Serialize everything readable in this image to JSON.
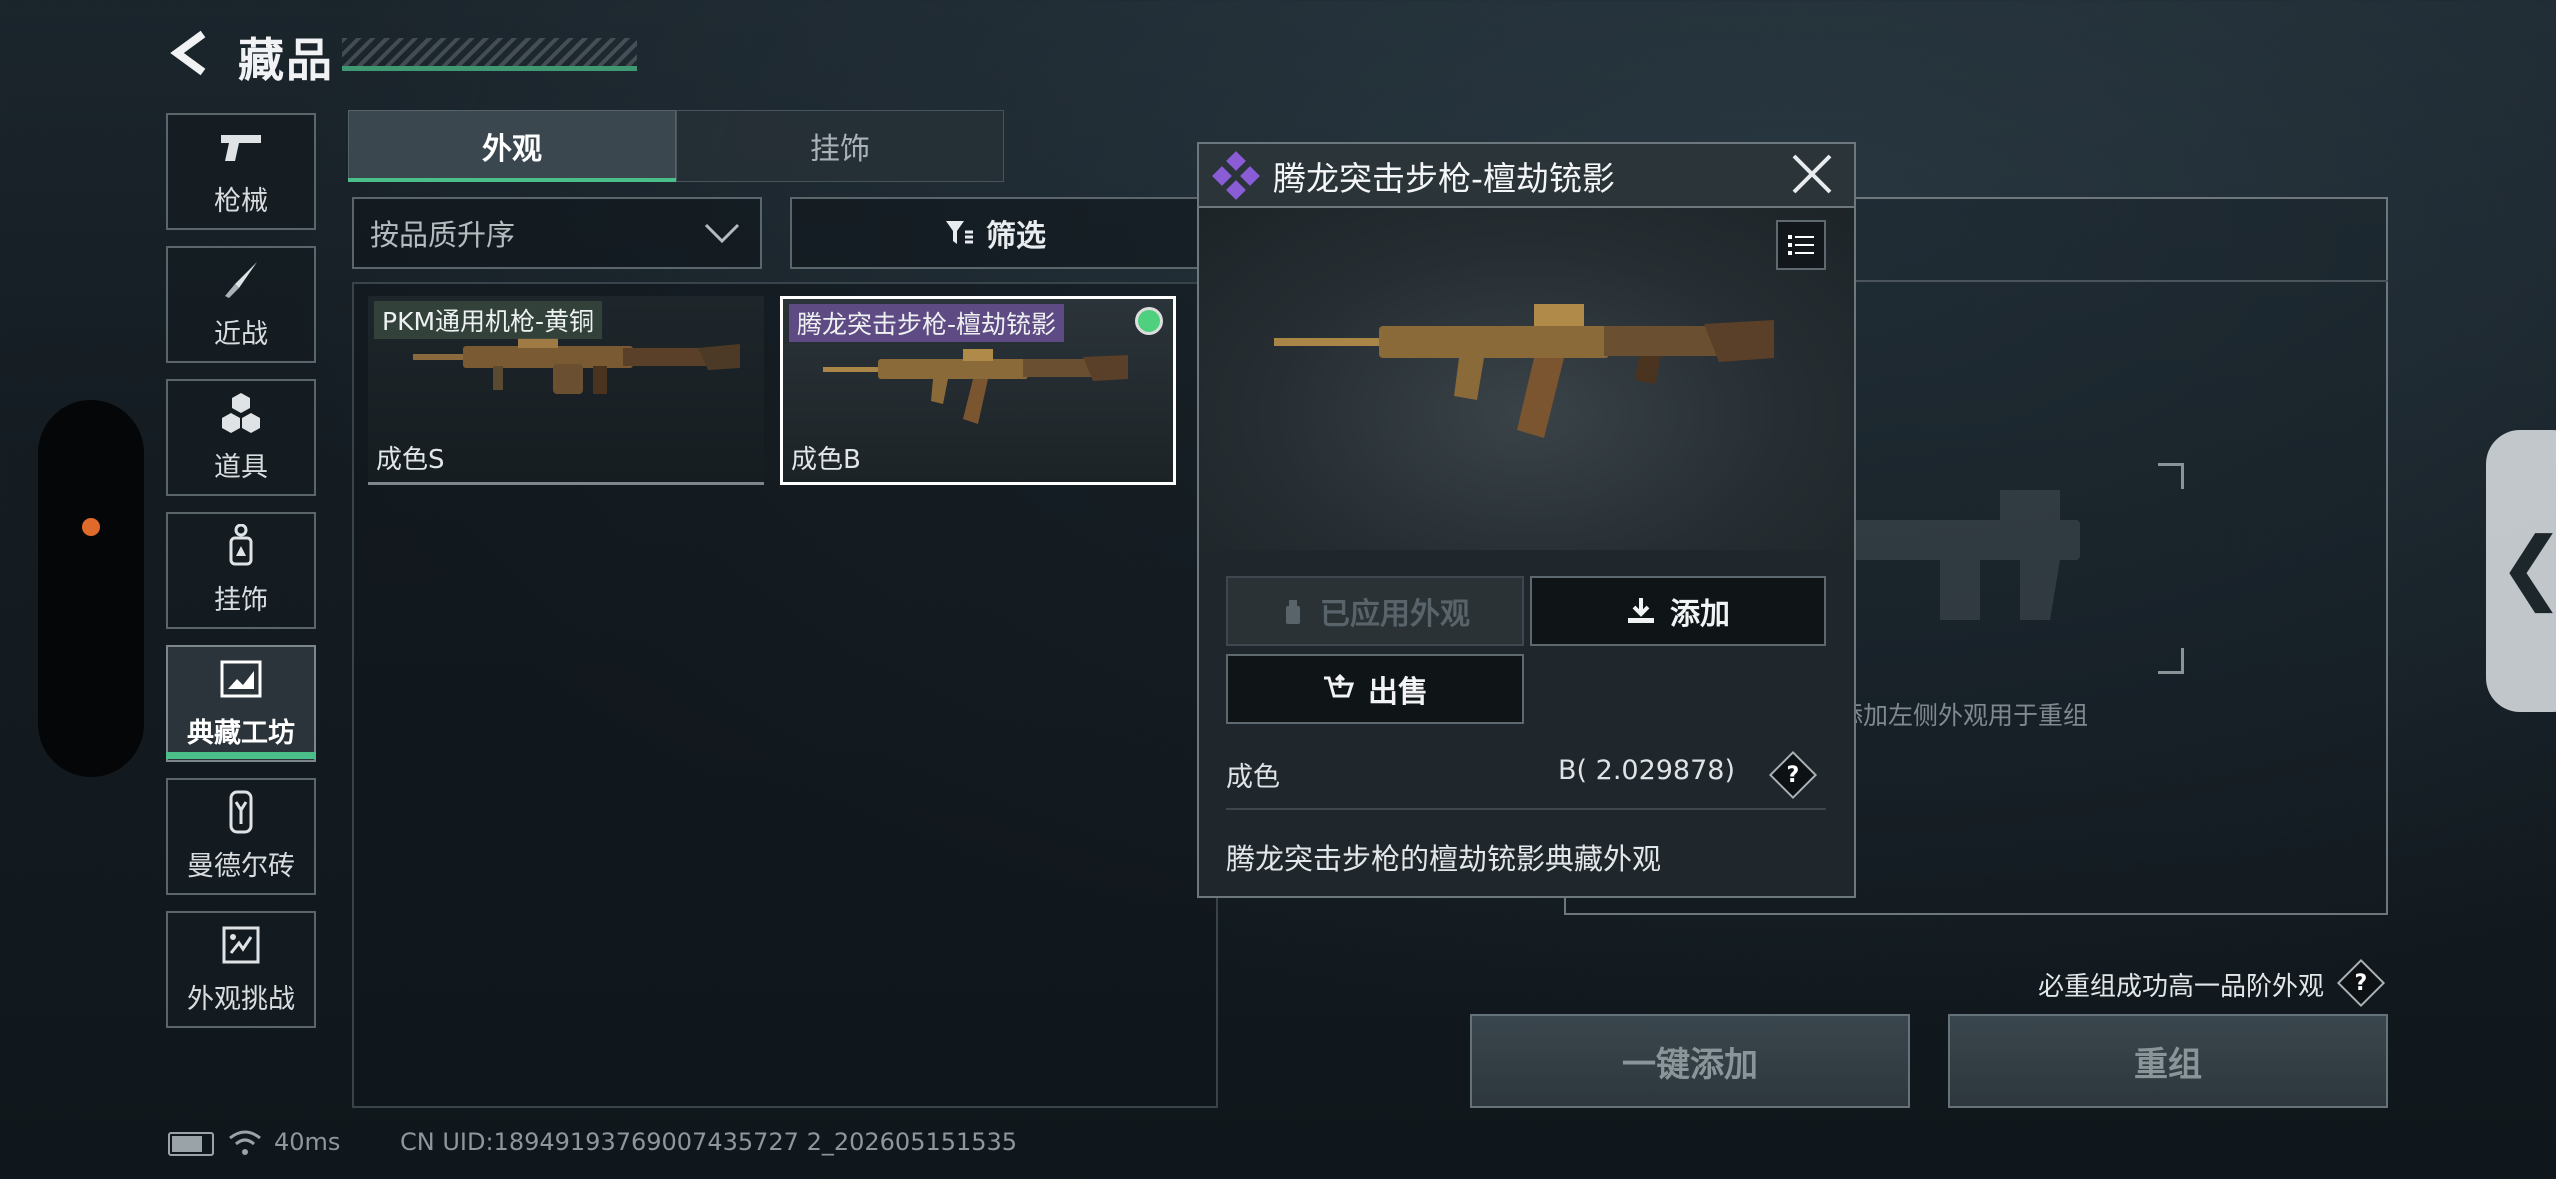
{
  "header": {
    "title": "藏品",
    "back_icon": "back-arrow-icon"
  },
  "nav": {
    "items": [
      {
        "label": "枪械",
        "icon": "pistol-icon"
      },
      {
        "label": "近战",
        "icon": "knife-icon"
      },
      {
        "label": "道具",
        "icon": "hexagon-items-icon"
      },
      {
        "label": "挂饰",
        "icon": "charm-icon"
      },
      {
        "label": "典藏工坊",
        "icon": "framed-picture-icon",
        "active": true
      },
      {
        "label": "曼德尔砖",
        "icon": "brick-icon"
      },
      {
        "label": "外观挑战",
        "icon": "challenge-icon"
      }
    ]
  },
  "tabs": [
    {
      "label": "外观",
      "active": true
    },
    {
      "label": "挂饰",
      "active": false
    }
  ],
  "toolbar": {
    "sort_label": "按品质升序",
    "filter_label": "筛选"
  },
  "cards": [
    {
      "name": "PKM通用机枪-黄铜",
      "condition": "成色S",
      "selected": false
    },
    {
      "name": "腾龙突击步枪-檀劫铳影",
      "condition": "成色B",
      "selected": true
    }
  ],
  "detail": {
    "title": "腾龙突击步枪-檀劫铳影",
    "rarity_color": "#8a5cd6",
    "applied_label": "已应用外观",
    "add_label": "添加",
    "sell_label": "出售",
    "condition_label": "成色",
    "condition_value": "B( 2.029878)",
    "help": "?",
    "description": "腾龙突击步枪的檀劫铳影典藏外观"
  },
  "reforge": {
    "hint": "添加左侧外观用于重组",
    "notice": "必重组成功高一品阶外观",
    "help": "?",
    "one_click_add": "一键添加",
    "reforge_label": "重组"
  },
  "status": {
    "ping": "40ms",
    "uid": "CN UID:18949193769007435727 2_202605151535"
  },
  "colors": {
    "accent": "#4bbf8a",
    "orange_dot": "#e06a2a"
  }
}
